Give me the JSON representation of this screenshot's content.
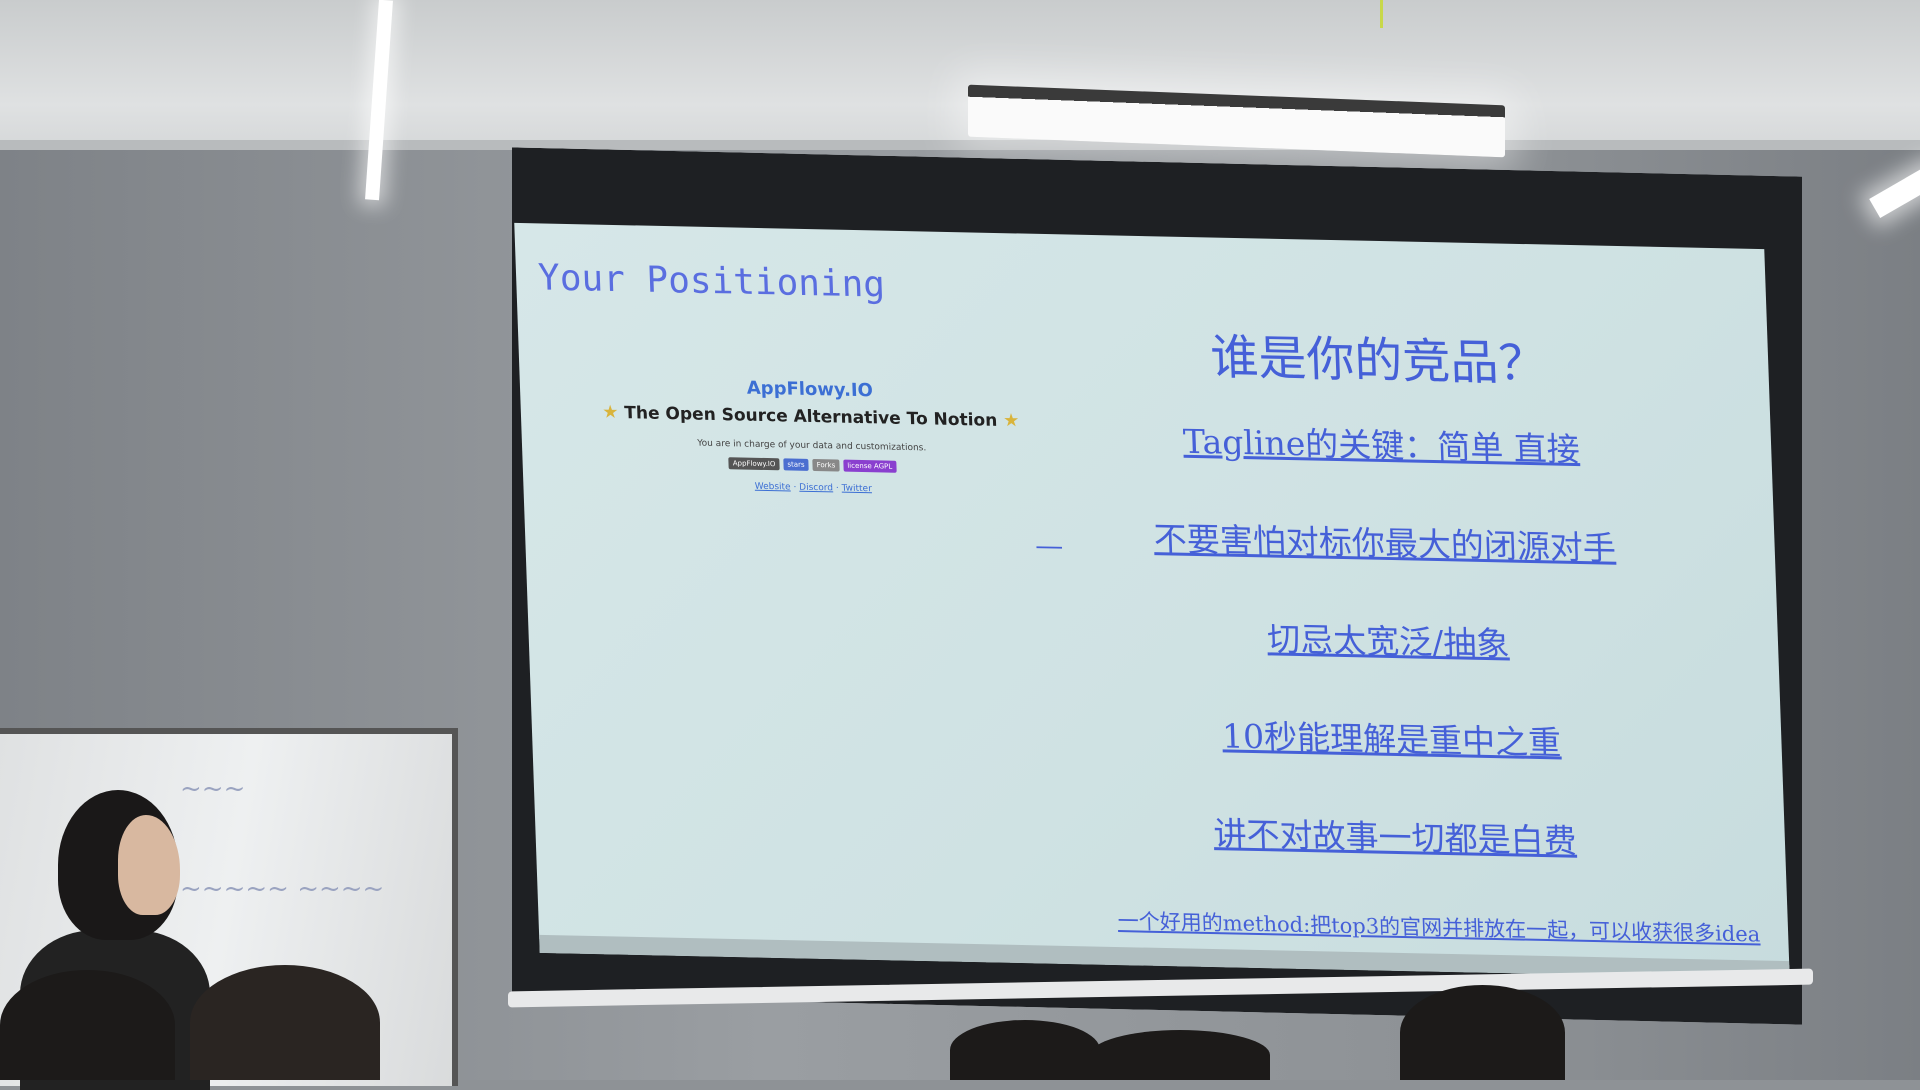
{
  "slide": {
    "title": "Your Positioning",
    "app_name": "AppFlowy.IO",
    "app_tagline": "The Open Source Alternative To Notion",
    "app_subtitle": "You are in charge of your data and customizations.",
    "badges": [
      "AppFlowy.IO",
      "stars",
      "Forks",
      "license AGPL"
    ],
    "links": [
      "Website",
      "Discord",
      "Twitter"
    ],
    "heading": "谁是你的竞品？",
    "points": [
      "Tagline的关键：简单 直接",
      "不要害怕对标你最大的闭源对手",
      "切忌太宽泛/抽象",
      "10秒能理解是重中之重",
      "讲不对故事一切都是白费"
    ],
    "dash": "—",
    "footer_note": "一个好用的method:把top3的官网并排放在一起，可以收获很多idea"
  },
  "colors": {
    "slide_text": "#4560d8",
    "slide_bg": "#d3e5e6"
  }
}
